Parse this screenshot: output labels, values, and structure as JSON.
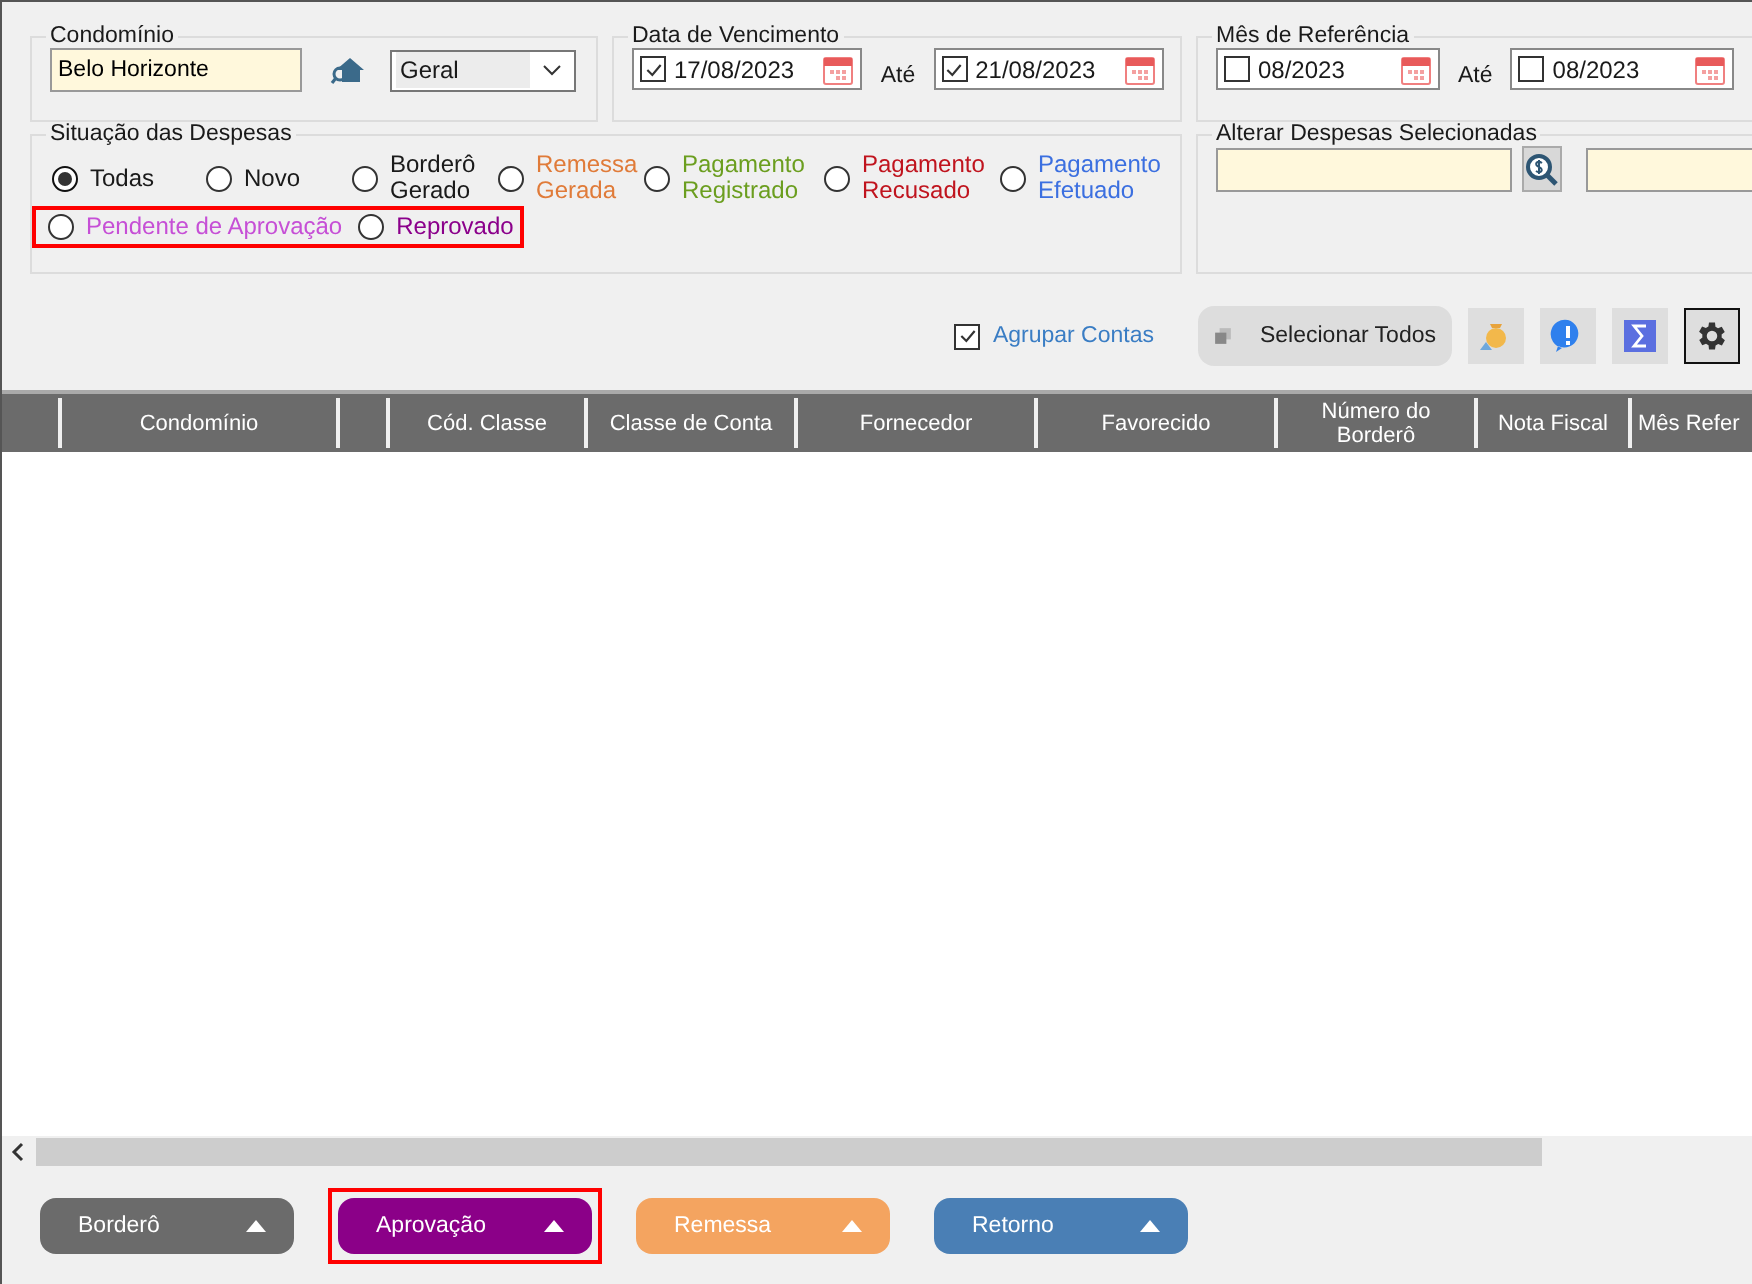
{
  "condominio": {
    "label": "Condomínio",
    "value": "Belo Horizonte",
    "type_select": "Geral"
  },
  "vencimento": {
    "label": "Data de Vencimento",
    "separator": "Até",
    "fields": [
      {
        "checked": true,
        "value": "17/08/2023"
      },
      {
        "checked": true,
        "value": "21/08/2023"
      }
    ]
  },
  "referencia": {
    "label": "Mês de Referência",
    "separator": "Até",
    "fields": [
      {
        "checked": false,
        "value": "08/2023"
      },
      {
        "checked": false,
        "value": "08/2023"
      }
    ]
  },
  "situacao": {
    "label": "Situação das Despesas",
    "rows": [
      {
        "highlighted": false,
        "options": [
          {
            "label": "Todas",
            "selected": true,
            "color": "#1a1a1a"
          },
          {
            "label": "Novo",
            "selected": false,
            "color": "#1a1a1a"
          },
          {
            "label": "Borderô Gerado",
            "selected": false,
            "color": "#1a1a1a"
          },
          {
            "label": "Remessa Gerada",
            "selected": false,
            "color": "#e07b39"
          },
          {
            "label": "Pagamento Registrado",
            "selected": false,
            "color": "#6b9e1f"
          },
          {
            "label": "Pagamento Recusado",
            "selected": false,
            "color": "#c0141e"
          },
          {
            "label": "Pagamento Efetuado",
            "selected": false,
            "color": "#3b6fe0"
          }
        ]
      },
      {
        "highlighted": true,
        "options": [
          {
            "label": "Pendente de Aprovação",
            "selected": false,
            "color": "#c64fd6"
          },
          {
            "label": "Reprovado",
            "selected": false,
            "color": "#8b008b"
          }
        ]
      }
    ]
  },
  "alterar": {
    "label": "Alterar Despesas Selecionadas"
  },
  "toolbar": {
    "agrupar": {
      "label": "Agrupar Contas",
      "checked": true
    },
    "select_all": "Selecionar Todos"
  },
  "table": {
    "columns": [
      {
        "kind": "blank"
      },
      {
        "kind": "text",
        "label": "Condomínio"
      },
      {
        "kind": "blank"
      },
      {
        "kind": "text",
        "label": "Cód. Classe"
      },
      {
        "kind": "text",
        "label": "Classe de Conta"
      },
      {
        "kind": "text",
        "label": "Fornecedor"
      },
      {
        "kind": "text",
        "label": "Favorecido"
      },
      {
        "kind": "text",
        "label": "Número do Borderô"
      },
      {
        "kind": "text",
        "label": "Nota Fiscal"
      },
      {
        "kind": "text",
        "label": "Mês Refer"
      }
    ]
  },
  "buttons": [
    {
      "label": "Borderô",
      "color": "#6b6b6b",
      "highlighted": false
    },
    {
      "label": "Aprovação",
      "color": "#8b0088",
      "highlighted": true
    },
    {
      "label": "Remessa",
      "color": "#f4a460",
      "highlighted": false
    },
    {
      "label": "Retorno",
      "color": "#4a7fb5",
      "highlighted": false
    }
  ]
}
